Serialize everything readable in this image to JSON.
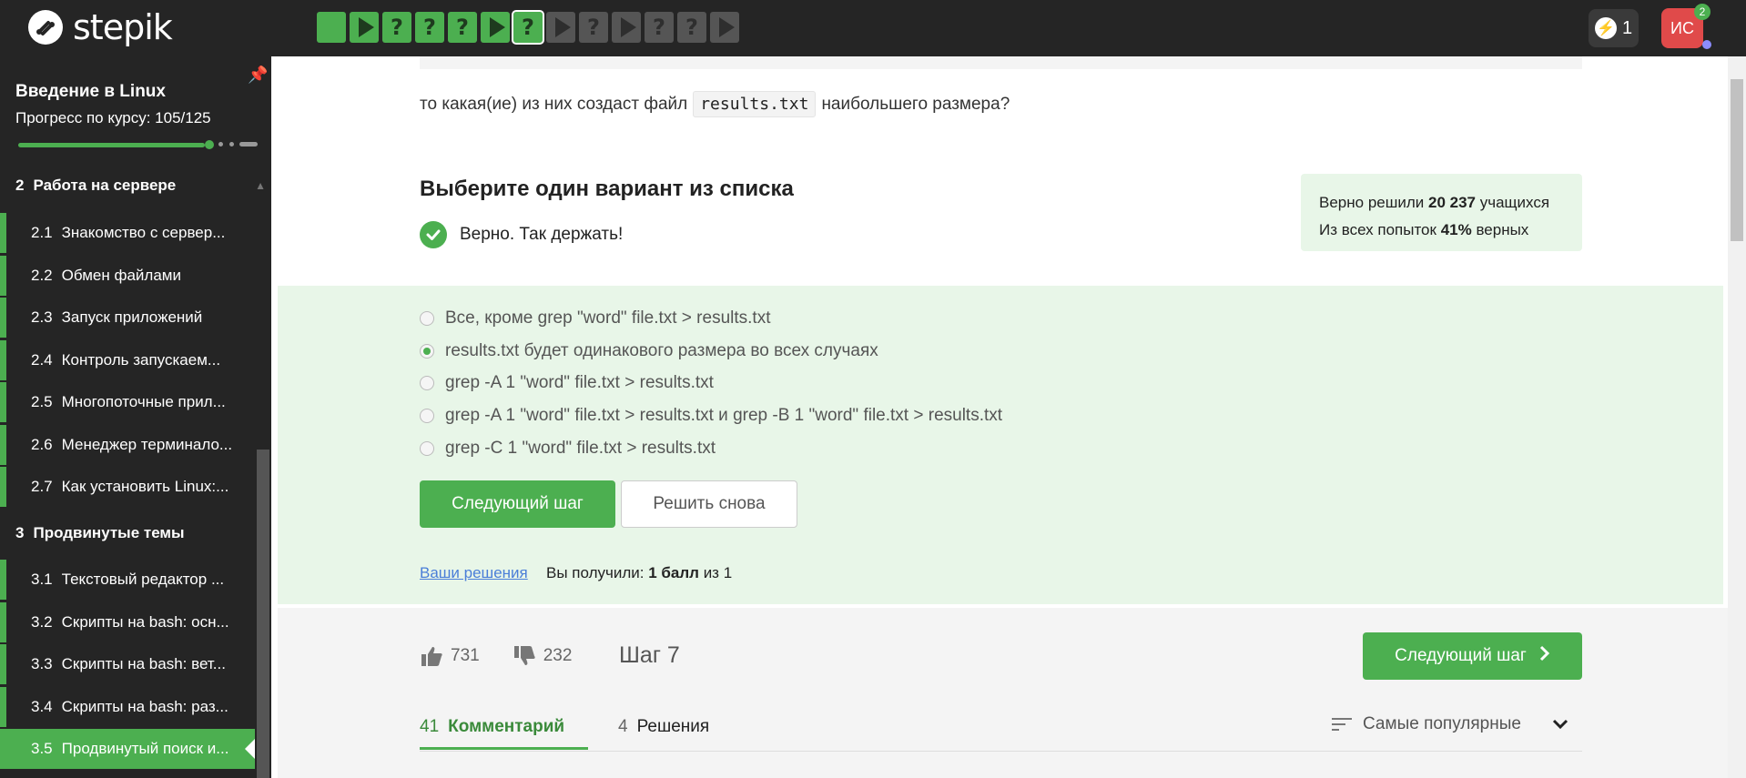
{
  "header": {
    "logo_text": "stepik",
    "steps": [
      {
        "kind": "square",
        "state": "done"
      },
      {
        "kind": "play",
        "state": "done"
      },
      {
        "kind": "quiz",
        "state": "done",
        "label": "?"
      },
      {
        "kind": "quiz",
        "state": "done",
        "label": "?"
      },
      {
        "kind": "quiz",
        "state": "done",
        "label": "?"
      },
      {
        "kind": "play",
        "state": "done"
      },
      {
        "kind": "quiz",
        "state": "current",
        "label": "?"
      },
      {
        "kind": "play",
        "state": "todo"
      },
      {
        "kind": "quiz",
        "state": "todo",
        "label": "?"
      },
      {
        "kind": "play",
        "state": "todo"
      },
      {
        "kind": "quiz",
        "state": "todo",
        "label": "?"
      },
      {
        "kind": "quiz",
        "state": "todo",
        "label": "?"
      },
      {
        "kind": "play",
        "state": "todo"
      }
    ],
    "energy_count": "1",
    "avatar_initials": "ИС",
    "notification_count": "2"
  },
  "sidebar": {
    "course_title": "Введение в Linux",
    "progress_label": "Прогресс по курсу:  105/125",
    "progress_fraction": 0.84,
    "sections": [
      {
        "num": "2",
        "title": "Работа на сервере"
      },
      {
        "num": "3",
        "title": "Продвинутые темы"
      }
    ],
    "lessons_s2": [
      {
        "num": "2.1",
        "title": "Знакомство с сервер..."
      },
      {
        "num": "2.2",
        "title": "Обмен файлами"
      },
      {
        "num": "2.3",
        "title": "Запуск приложений"
      },
      {
        "num": "2.4",
        "title": "Контроль запускаем..."
      },
      {
        "num": "2.5",
        "title": "Многопоточные прил..."
      },
      {
        "num": "2.6",
        "title": "Менеджер терминало..."
      },
      {
        "num": "2.7",
        "title": "Как установить Linux:..."
      }
    ],
    "lessons_s3": [
      {
        "num": "3.1",
        "title": "Текстовый редактор ..."
      },
      {
        "num": "3.2",
        "title": "Скрипты на bash: осн..."
      },
      {
        "num": "3.3",
        "title": "Скрипты на bash: вет..."
      },
      {
        "num": "3.4",
        "title": "Скрипты на bash: раз..."
      },
      {
        "num": "3.5",
        "title": "Продвинутый поиск и..."
      }
    ]
  },
  "question": {
    "prefix": "то какая(ие) из них создаст файл",
    "code": "results.txt",
    "suffix": "наибольшего размера?"
  },
  "quiz": {
    "heading": "Выберите один вариант из списка",
    "result": "Верно. Так держать!",
    "stats_line1_pre": "Верно решили",
    "stats_line1_num": "20 237",
    "stats_line1_post": "учащихся",
    "stats_line2_pre": "Из всех попыток",
    "stats_line2_num": "41%",
    "stats_line2_post": "верных",
    "options": [
      {
        "text": "Все, кроме grep \"word\" file.txt > results.txt",
        "selected": false
      },
      {
        "text": "results.txt будет одинакового размера во всех случаях",
        "selected": true
      },
      {
        "text": "grep -A 1 \"word\" file.txt > results.txt",
        "selected": false
      },
      {
        "text": "grep -A 1 \"word\" file.txt > results.txt и grep -B 1 \"word\" file.txt > results.txt",
        "selected": false
      },
      {
        "text": "grep -C 1 \"word\" file.txt > results.txt",
        "selected": false
      }
    ],
    "next_button": "Следующий шаг",
    "retry_button": "Решить снова",
    "your_solutions": "Ваши решения",
    "score_pre": "Вы получили:",
    "score_bold": "1 балл",
    "score_mid": "из",
    "score_total": "1"
  },
  "footer": {
    "likes": "731",
    "dislikes": "232",
    "step_label": "Шаг 7",
    "next_button": "Следующий шаг",
    "tabs": [
      {
        "count": "41",
        "label": "Комментарий",
        "active": true
      },
      {
        "count": "4",
        "label": "Решения",
        "active": false
      }
    ],
    "sort_label": "Самые популярные"
  },
  "colors": {
    "accent": "#4caf50",
    "topbar": "#252525",
    "answer_bg": "#e8f6e8",
    "link": "#4a7ed8"
  }
}
